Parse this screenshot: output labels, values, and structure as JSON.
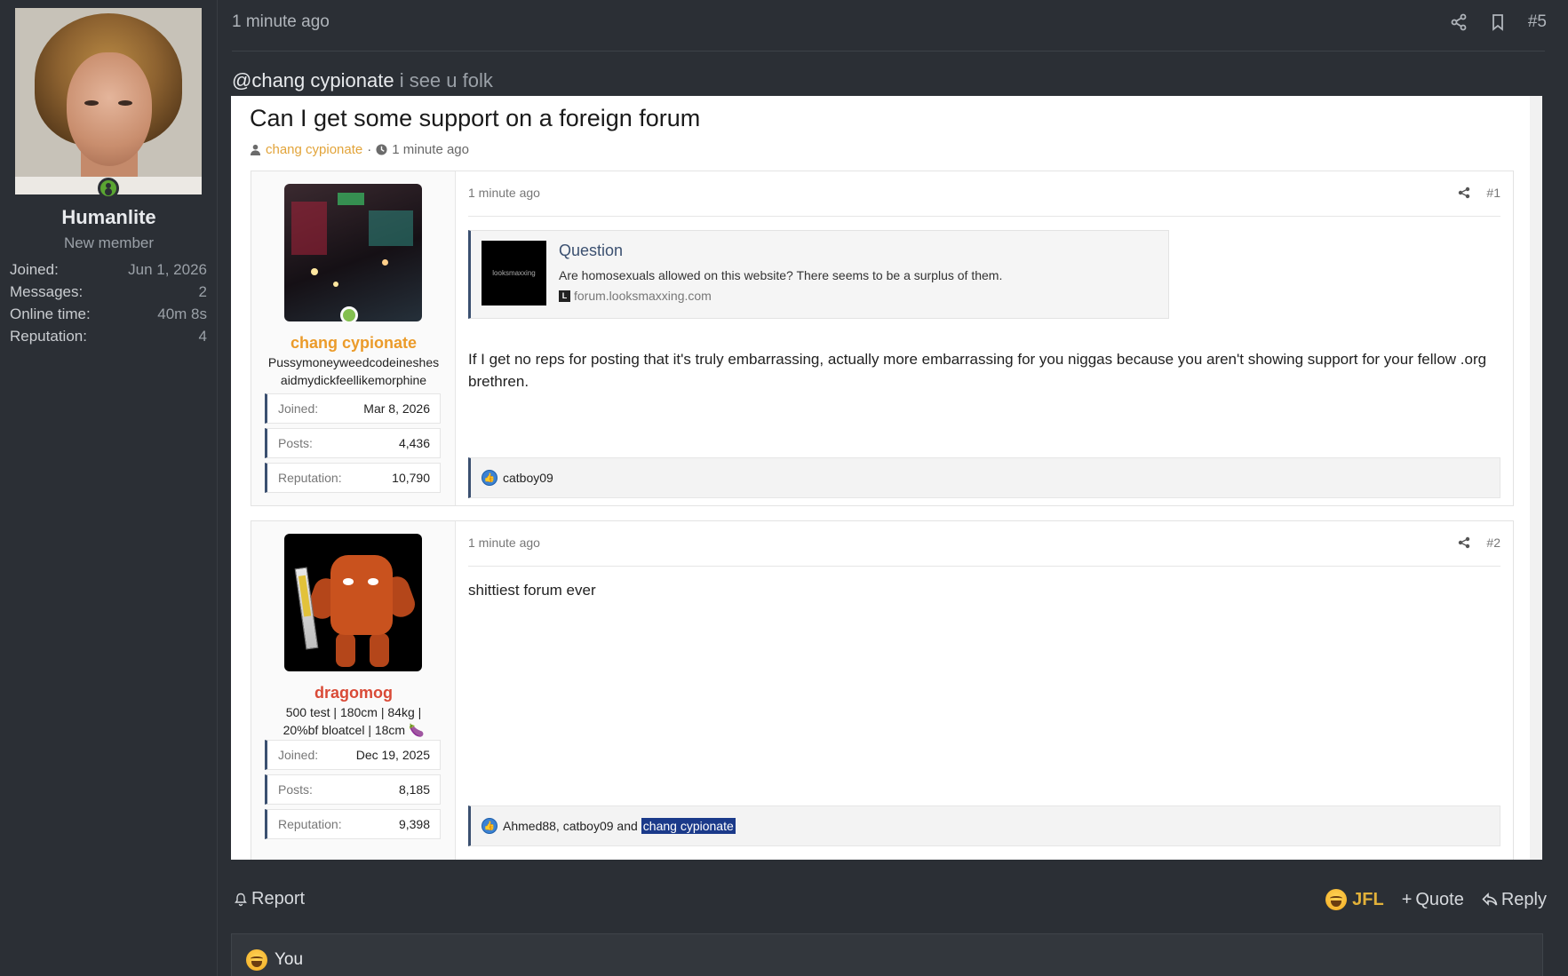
{
  "user": {
    "name": "Humanlite",
    "title": "New member",
    "stats": [
      {
        "label": "Joined:",
        "value": "Jun 1, 2026"
      },
      {
        "label": "Messages:",
        "value": "2"
      },
      {
        "label": "Online time:",
        "value": "40m 8s"
      },
      {
        "label": "Reputation:",
        "value": "4"
      }
    ]
  },
  "post": {
    "time": "1 minute ago",
    "number": "#5",
    "mention": "@chang cypionate",
    "text_rest": " i see u folk"
  },
  "embed": {
    "thread_title": "Can I get some support on a foreign forum",
    "thread_author": "chang cypionate",
    "thread_sep": "·",
    "thread_time": "1 minute ago",
    "posts": [
      {
        "author": "chang cypionate",
        "user_title": "Pussymoneyweedcodeineshesaidmydickfeellikemorphine",
        "stats": [
          {
            "label": "Joined:",
            "value": "Mar 8, 2026"
          },
          {
            "label": "Posts:",
            "value": "4,436"
          },
          {
            "label": "Reputation:",
            "value": "10,790"
          }
        ],
        "time": "1 minute ago",
        "number": "#1",
        "unfurl": {
          "title": "Question",
          "description": "Are homosexuals allowed on this website? There seems to be a surplus of them.",
          "source": "forum.looksmaxxing.com",
          "thumb_text": "looksmaxxing",
          "favicon": "L"
        },
        "body": "If I get no reps for posting that it's truly embarrassing, actually more embarrassing for you niggas because you aren't showing support for your fellow .org brethren.",
        "reactions": "catboy09"
      },
      {
        "author": "dragomog",
        "user_title": "500 test | 180cm | 84kg | 20%bf bloatcel | 18cm 🍆",
        "stats": [
          {
            "label": "Joined:",
            "value": "Dec 19, 2025"
          },
          {
            "label": "Posts:",
            "value": "8,185"
          },
          {
            "label": "Reputation:",
            "value": "9,398"
          }
        ],
        "time": "1 minute ago",
        "number": "#2",
        "body": "shittiest forum ever",
        "reactions_prefix": "Ahmed88, catboy09 and ",
        "reactions_selected": "chang cypionate"
      }
    ]
  },
  "footer": {
    "report": "Report",
    "jfl": "JFL",
    "quote": "Quote",
    "reply": "Reply",
    "reaction_user": "You"
  },
  "colors": {
    "background": "#2b2f35",
    "username_orange": "#eb9b2a",
    "username_red": "#d94a37",
    "jfl_gold": "#e2b13a"
  }
}
